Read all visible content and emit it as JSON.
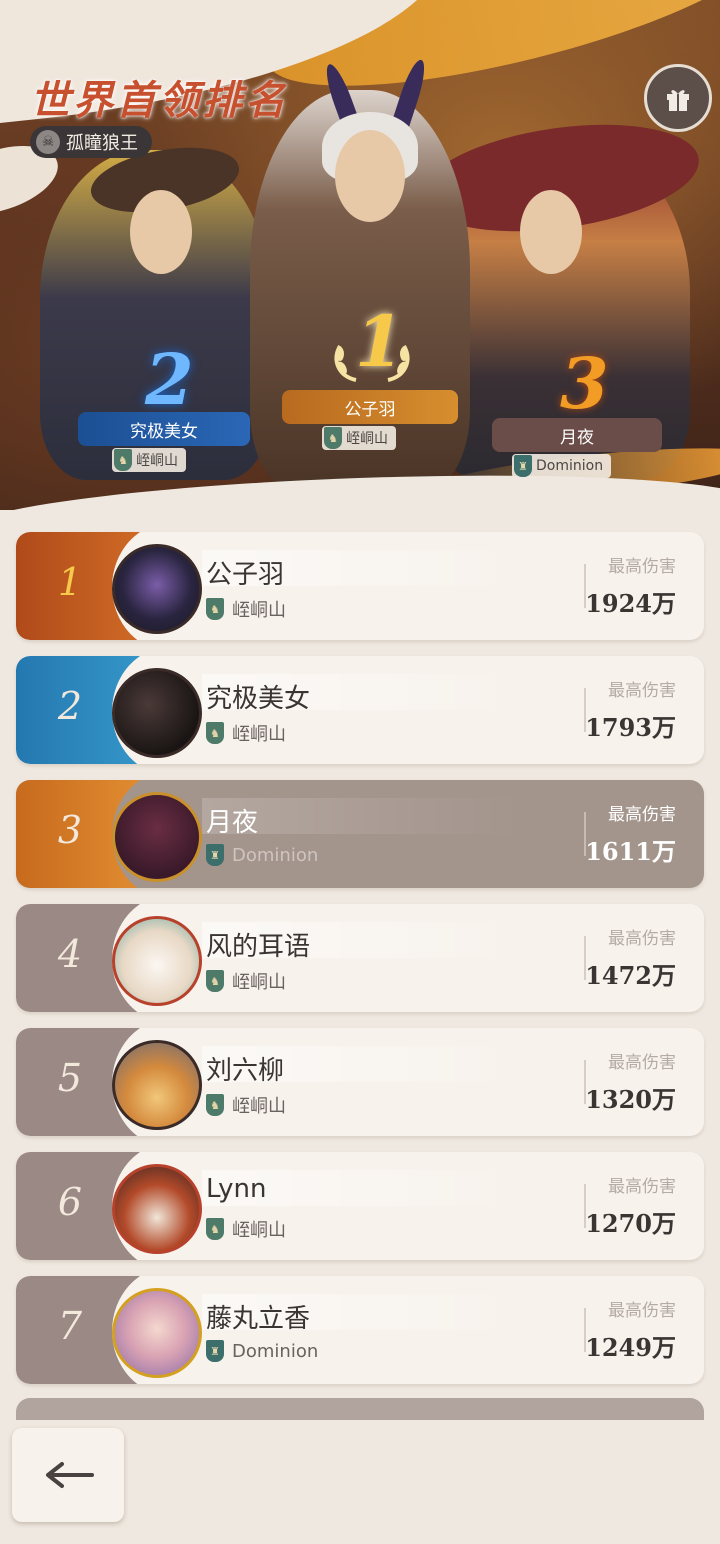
{
  "header": {
    "title": "世界首领排名",
    "boss_name": "孤瞳狼王"
  },
  "podium": [
    {
      "rank": "1",
      "name": "公子羽",
      "guild": "峌峒山"
    },
    {
      "rank": "2",
      "name": "究极美女",
      "guild": "峌峒山"
    },
    {
      "rank": "3",
      "name": "月夜",
      "guild": "Dominion"
    }
  ],
  "leaderboard": {
    "stat_label": "最高伤害",
    "rows": [
      {
        "rank": "1",
        "name": "公子羽",
        "guild": "峌峒山",
        "value": "1924万"
      },
      {
        "rank": "2",
        "name": "究极美女",
        "guild": "峌峒山",
        "value": "1793万"
      },
      {
        "rank": "3",
        "name": "月夜",
        "guild": "Dominion",
        "value": "1611万"
      },
      {
        "rank": "4",
        "name": "风的耳语",
        "guild": "峌峒山",
        "value": "1472万"
      },
      {
        "rank": "5",
        "name": "刘六柳",
        "guild": "峌峒山",
        "value": "1320万"
      },
      {
        "rank": "6",
        "name": "Lynn",
        "guild": "峌峒山",
        "value": "1270万"
      },
      {
        "rank": "7",
        "name": "藤丸立香",
        "guild": "Dominion",
        "value": "1249万"
      }
    ]
  },
  "icons": {
    "gift": "gift-icon",
    "back": "back-arrow-icon",
    "boss": "wolf-skull-icon",
    "guild": "guild-emblem-icon"
  },
  "colors": {
    "rank1": "#d9752a",
    "rank2": "#3aa0d0",
    "rank3": "#e99837",
    "highlight_row": "#a3948c",
    "title": "#c7502f"
  }
}
